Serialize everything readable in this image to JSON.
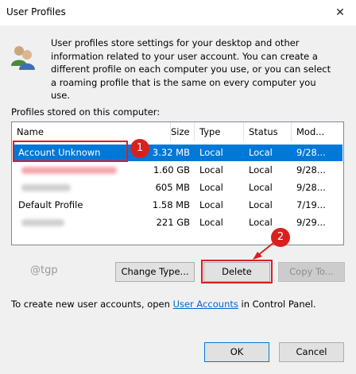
{
  "window": {
    "title": "User Profiles",
    "close_glyph": "✕"
  },
  "description": "User profiles store settings for your desktop and other information related to your user account. You can create a different profile on each computer you use, or you can select a roaming profile that is the same on every computer you use.",
  "profiles_label": "Profiles stored on this computer:",
  "columns": [
    "Name",
    "Size",
    "Type",
    "Status",
    "Mod..."
  ],
  "rows": [
    {
      "name": "Account Unknown",
      "size": "3.32 MB",
      "type": "Local",
      "status": "Local",
      "modified": "9/28...",
      "selected": true,
      "redacted": false
    },
    {
      "name": "",
      "size": "1.60 GB",
      "type": "Local",
      "status": "Local",
      "modified": "9/28...",
      "selected": false,
      "redacted": true,
      "redaction_color": "#f4a7ad"
    },
    {
      "name": "",
      "size": "605 MB",
      "type": "Local",
      "status": "Local",
      "modified": "9/28...",
      "selected": false,
      "redacted": true,
      "redaction_color": "#d0d0d0"
    },
    {
      "name": "Default Profile",
      "size": "1.58 MB",
      "type": "Local",
      "status": "Local",
      "modified": "7/19...",
      "selected": false,
      "redacted": false
    },
    {
      "name": "",
      "size": "221 GB",
      "type": "Local",
      "status": "Local",
      "modified": "9/29...",
      "selected": false,
      "redacted": true,
      "redaction_color": "#d0d0d0"
    }
  ],
  "buttons": {
    "change_type": "Change Type...",
    "delete": "Delete",
    "copy_to": "Copy To...",
    "ok": "OK",
    "cancel": "Cancel"
  },
  "watermark": "@tgp",
  "footer": {
    "prefix": "To create new user accounts, open ",
    "link": "User Accounts",
    "suffix": " in Control Panel."
  },
  "annotations": {
    "step1": "1",
    "step2": "2",
    "color": "#d9201f"
  },
  "colors": {
    "selection": "#0078d7",
    "link": "#0066cc"
  },
  "icons": {
    "users": "users-icon"
  }
}
